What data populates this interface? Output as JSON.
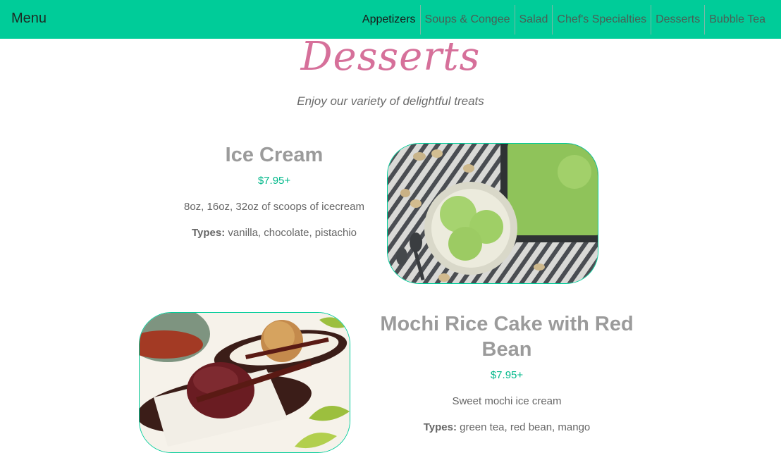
{
  "navbar": {
    "brand": "Menu",
    "items": [
      {
        "label": "Appetizers"
      },
      {
        "label": "Soups & Congee"
      },
      {
        "label": "Salad"
      },
      {
        "label": "Chef's Specialties"
      },
      {
        "label": "Desserts"
      },
      {
        "label": "Bubble Tea"
      }
    ]
  },
  "section": {
    "title": "Desserts",
    "subtitle": "Enjoy our variety of delightful treats"
  },
  "items": [
    {
      "name": "Ice Cream",
      "price": "$7.95+",
      "description": "8oz, 16oz, 32oz of scoops of icecream",
      "types_label": "Types:",
      "types": "vanilla, chocolate, pistachio",
      "image": "ice-cream-photo"
    },
    {
      "name": "Mochi Rice Cake with Red Bean",
      "price": "$7.95+",
      "description": "Sweet mochi ice cream",
      "types_label": "Types:",
      "types": "green tea, red bean, mango",
      "image": "mochi-photo"
    }
  ],
  "colors": {
    "navbar": "#00cc99",
    "title": "#d6709a",
    "price": "#00b88a"
  }
}
